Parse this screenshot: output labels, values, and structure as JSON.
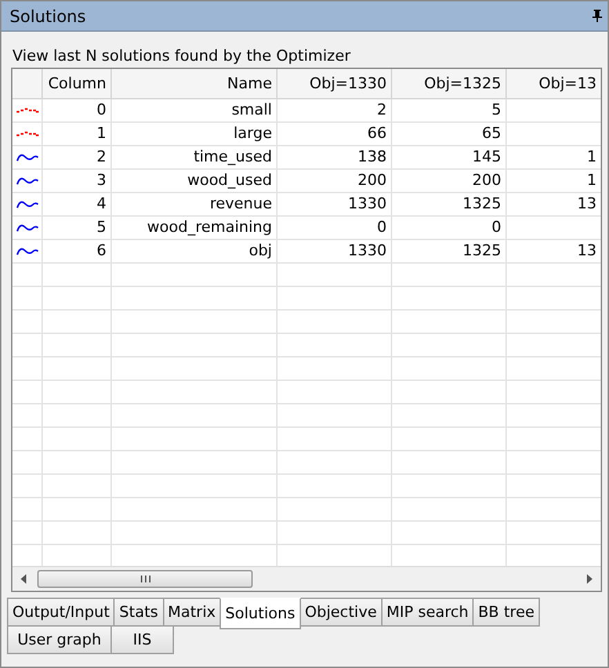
{
  "window": {
    "title": "Solutions"
  },
  "caption": "View last N solutions found by the Optimizer",
  "table": {
    "columns": [
      "Column",
      "Name",
      "Obj=1330",
      "Obj=1325",
      "Obj=13"
    ],
    "rows": [
      {
        "kind": "integer",
        "cells": [
          "0",
          "small",
          "2",
          "5",
          ""
        ]
      },
      {
        "kind": "integer",
        "cells": [
          "1",
          "large",
          "66",
          "65",
          ""
        ]
      },
      {
        "kind": "continuous",
        "cells": [
          "2",
          "time_used",
          "138",
          "145",
          "1"
        ]
      },
      {
        "kind": "continuous",
        "cells": [
          "3",
          "wood_used",
          "200",
          "200",
          "1"
        ]
      },
      {
        "kind": "continuous",
        "cells": [
          "4",
          "revenue",
          "1330",
          "1325",
          "13"
        ]
      },
      {
        "kind": "continuous",
        "cells": [
          "5",
          "wood_remaining",
          "0",
          "0",
          ""
        ]
      },
      {
        "kind": "continuous",
        "cells": [
          "6",
          "obj",
          "1330",
          "1325",
          "13"
        ]
      }
    ]
  },
  "tabs": [
    {
      "label": "Output/Input",
      "selected": false
    },
    {
      "label": "Stats",
      "selected": false
    },
    {
      "label": "Matrix",
      "selected": false
    },
    {
      "label": "Solutions",
      "selected": true
    },
    {
      "label": "Objective",
      "selected": false
    },
    {
      "label": "MIP search",
      "selected": false
    },
    {
      "label": "BB tree",
      "selected": false
    },
    {
      "label": "User graph",
      "selected": false
    },
    {
      "label": "IIS",
      "selected": false
    }
  ]
}
